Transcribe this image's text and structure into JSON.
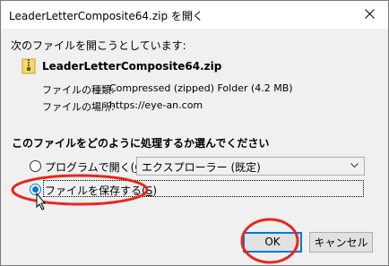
{
  "dialog": {
    "title": "LeaderLetterComposite64.zip を開く",
    "close_icon": "close-icon"
  },
  "prompt": "次のファイルを開こうとしています:",
  "file": {
    "icon": "zip-folder-icon",
    "name": "LeaderLetterComposite64.zip",
    "type_label": "ファイルの種類:",
    "type_value": "Compressed (zipped) Folder (4.2 MB)",
    "location_label": "ファイルの場所:",
    "location_value": "https://eye-an.com"
  },
  "action": {
    "heading": "このファイルをどのように処理するか選んでください",
    "open_with": {
      "label_prefix": "プログラムで開く(",
      "accesskey": "O",
      "label_suffix": "):",
      "checked": false
    },
    "app_select": {
      "selected": "エクスプローラー (既定)"
    },
    "save_file": {
      "label_prefix": "ファイルを保存する(",
      "accesskey": "S",
      "label_suffix": ")",
      "checked": true
    }
  },
  "buttons": {
    "ok": "OK",
    "cancel": "キャンセル"
  },
  "colors": {
    "accent": "#0078d7",
    "annotation": "#e8261c",
    "client_bg": "#f0f0f0"
  }
}
